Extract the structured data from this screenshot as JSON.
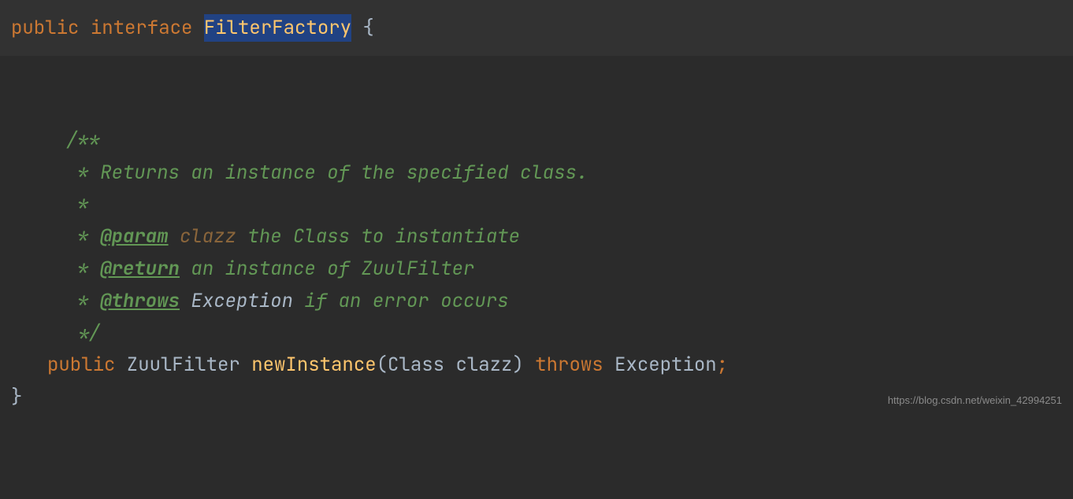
{
  "declaration": {
    "public": "public",
    "interface": "interface",
    "name": "FilterFactory",
    "openBrace": " {"
  },
  "javadoc": {
    "open": "/**",
    "star": " *",
    "desc": " * Returns an instance of the specified class.",
    "paramPrefix": " * ",
    "paramTag": "@param",
    "paramName": " clazz",
    "paramDesc": " the Class to instantiate",
    "returnTag": "@return",
    "returnDesc": " an instance of ZuulFilter",
    "throwsTag": "@throws",
    "throwsClass": " Exception",
    "throwsDesc": " if an error occurs",
    "close": " */"
  },
  "method": {
    "public": "public",
    "returnType": " ZuulFilter ",
    "name": "newInstance",
    "open": "(",
    "paramType": "Class ",
    "paramName": "clazz",
    "close": ") ",
    "throws": "throws",
    "exceptionType": " Exception",
    "semi": ";"
  },
  "closeBrace": "}",
  "watermark": "https://blog.csdn.net/weixin_42994251"
}
